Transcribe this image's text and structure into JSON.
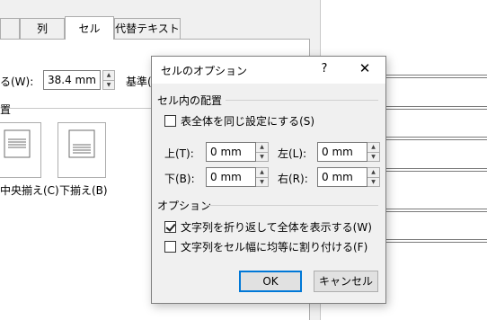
{
  "background": {
    "tabs": [
      "列",
      "セル",
      "代替テキスト"
    ],
    "width_label": "る(W):",
    "width_value": "38.4 mm",
    "basis_label": "基準(",
    "group_mark": "置",
    "align_center_label": "中央揃え(C)",
    "align_bottom_label": "下揃え(B)"
  },
  "dialog": {
    "title": "セルのオプション",
    "help": "?",
    "close": "✕",
    "section_margins": "セル内の配置",
    "same_as_table": "表全体を同じ設定にする(S)",
    "fields": {
      "top_label": "上(T):",
      "top_value": "0 mm",
      "left_label": "左(L):",
      "left_value": "0 mm",
      "bottom_label": "下(B):",
      "bottom_value": "0 mm",
      "right_label": "右(R):",
      "right_value": "0 mm"
    },
    "section_options": "オプション",
    "wrap_text": "文字列を折り返して全体を表示する(W)",
    "wrap_checked": true,
    "fit_text": "文字列をセル幅に均等に割り付ける(F)",
    "fit_checked": false,
    "ok": "OK",
    "cancel": "キャンセル"
  }
}
